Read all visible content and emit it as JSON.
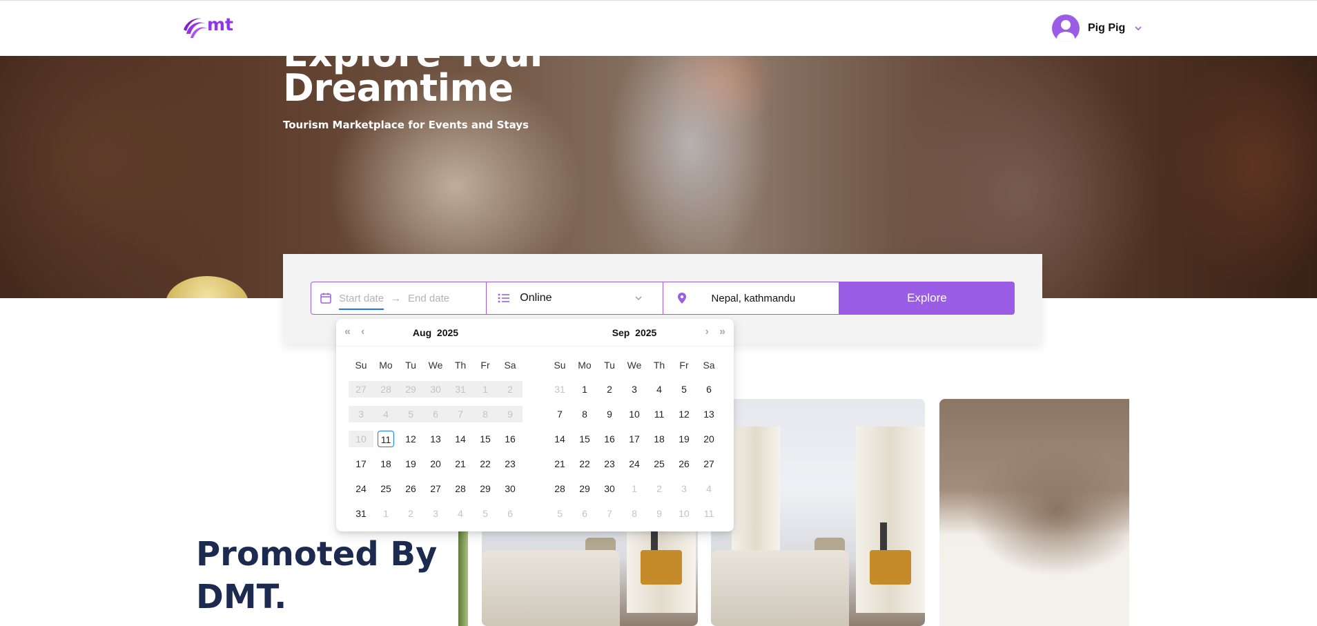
{
  "header": {
    "logo_text": "mt",
    "user_name": "Pig Pig",
    "brand_color": "#9333ea"
  },
  "hero": {
    "title_partial": "Explore Your",
    "title": "Dreamtime",
    "subtitle": "Tourism Marketplace for Events and Stays"
  },
  "search": {
    "start_placeholder": "Start date",
    "end_placeholder": "End date",
    "arrow": "→",
    "mode_value": "Online",
    "location_value": "Nepal, kathmandu",
    "explore_label": "Explore",
    "accent": "#9b5de5"
  },
  "calendar": {
    "left": {
      "month": "Aug",
      "year": "2025",
      "weekdays": [
        "Su",
        "Mo",
        "Tu",
        "We",
        "Th",
        "Fr",
        "Sa"
      ],
      "days": [
        {
          "d": "27",
          "s": "dis"
        },
        {
          "d": "28",
          "s": "dis"
        },
        {
          "d": "29",
          "s": "dis"
        },
        {
          "d": "30",
          "s": "dis"
        },
        {
          "d": "31",
          "s": "dis"
        },
        {
          "d": "1",
          "s": "dis"
        },
        {
          "d": "2",
          "s": "dis"
        },
        {
          "d": "3",
          "s": "dis"
        },
        {
          "d": "4",
          "s": "dis"
        },
        {
          "d": "5",
          "s": "dis"
        },
        {
          "d": "6",
          "s": "dis"
        },
        {
          "d": "7",
          "s": "dis"
        },
        {
          "d": "8",
          "s": "dis"
        },
        {
          "d": "9",
          "s": "dis"
        },
        {
          "d": "10",
          "s": "dis"
        },
        {
          "d": "11",
          "s": "today"
        },
        {
          "d": "12",
          "s": ""
        },
        {
          "d": "13",
          "s": ""
        },
        {
          "d": "14",
          "s": ""
        },
        {
          "d": "15",
          "s": ""
        },
        {
          "d": "16",
          "s": ""
        },
        {
          "d": "17",
          "s": ""
        },
        {
          "d": "18",
          "s": ""
        },
        {
          "d": "19",
          "s": ""
        },
        {
          "d": "20",
          "s": ""
        },
        {
          "d": "21",
          "s": ""
        },
        {
          "d": "22",
          "s": ""
        },
        {
          "d": "23",
          "s": ""
        },
        {
          "d": "24",
          "s": ""
        },
        {
          "d": "25",
          "s": ""
        },
        {
          "d": "26",
          "s": ""
        },
        {
          "d": "27",
          "s": ""
        },
        {
          "d": "28",
          "s": ""
        },
        {
          "d": "29",
          "s": ""
        },
        {
          "d": "30",
          "s": ""
        },
        {
          "d": "31",
          "s": ""
        },
        {
          "d": "1",
          "s": "out"
        },
        {
          "d": "2",
          "s": "out"
        },
        {
          "d": "3",
          "s": "out"
        },
        {
          "d": "4",
          "s": "out"
        },
        {
          "d": "5",
          "s": "out"
        },
        {
          "d": "6",
          "s": "out"
        }
      ]
    },
    "right": {
      "month": "Sep",
      "year": "2025",
      "weekdays": [
        "Su",
        "Mo",
        "Tu",
        "We",
        "Th",
        "Fr",
        "Sa"
      ],
      "days": [
        {
          "d": "31",
          "s": "out"
        },
        {
          "d": "1",
          "s": ""
        },
        {
          "d": "2",
          "s": ""
        },
        {
          "d": "3",
          "s": ""
        },
        {
          "d": "4",
          "s": ""
        },
        {
          "d": "5",
          "s": ""
        },
        {
          "d": "6",
          "s": ""
        },
        {
          "d": "7",
          "s": ""
        },
        {
          "d": "8",
          "s": ""
        },
        {
          "d": "9",
          "s": ""
        },
        {
          "d": "10",
          "s": ""
        },
        {
          "d": "11",
          "s": ""
        },
        {
          "d": "12",
          "s": ""
        },
        {
          "d": "13",
          "s": ""
        },
        {
          "d": "14",
          "s": ""
        },
        {
          "d": "15",
          "s": ""
        },
        {
          "d": "16",
          "s": ""
        },
        {
          "d": "17",
          "s": ""
        },
        {
          "d": "18",
          "s": ""
        },
        {
          "d": "19",
          "s": ""
        },
        {
          "d": "20",
          "s": ""
        },
        {
          "d": "21",
          "s": ""
        },
        {
          "d": "22",
          "s": ""
        },
        {
          "d": "23",
          "s": ""
        },
        {
          "d": "24",
          "s": ""
        },
        {
          "d": "25",
          "s": ""
        },
        {
          "d": "26",
          "s": ""
        },
        {
          "d": "27",
          "s": ""
        },
        {
          "d": "28",
          "s": ""
        },
        {
          "d": "29",
          "s": ""
        },
        {
          "d": "30",
          "s": ""
        },
        {
          "d": "1",
          "s": "out"
        },
        {
          "d": "2",
          "s": "out"
        },
        {
          "d": "3",
          "s": "out"
        },
        {
          "d": "4",
          "s": "out"
        },
        {
          "d": "5",
          "s": "out"
        },
        {
          "d": "6",
          "s": "out"
        },
        {
          "d": "7",
          "s": "out"
        },
        {
          "d": "8",
          "s": "out"
        },
        {
          "d": "9",
          "s": "out"
        },
        {
          "d": "10",
          "s": "out"
        },
        {
          "d": "11",
          "s": "out"
        }
      ]
    }
  },
  "promo": {
    "title_line1": "Promoted By",
    "title_line2": "DMT."
  }
}
